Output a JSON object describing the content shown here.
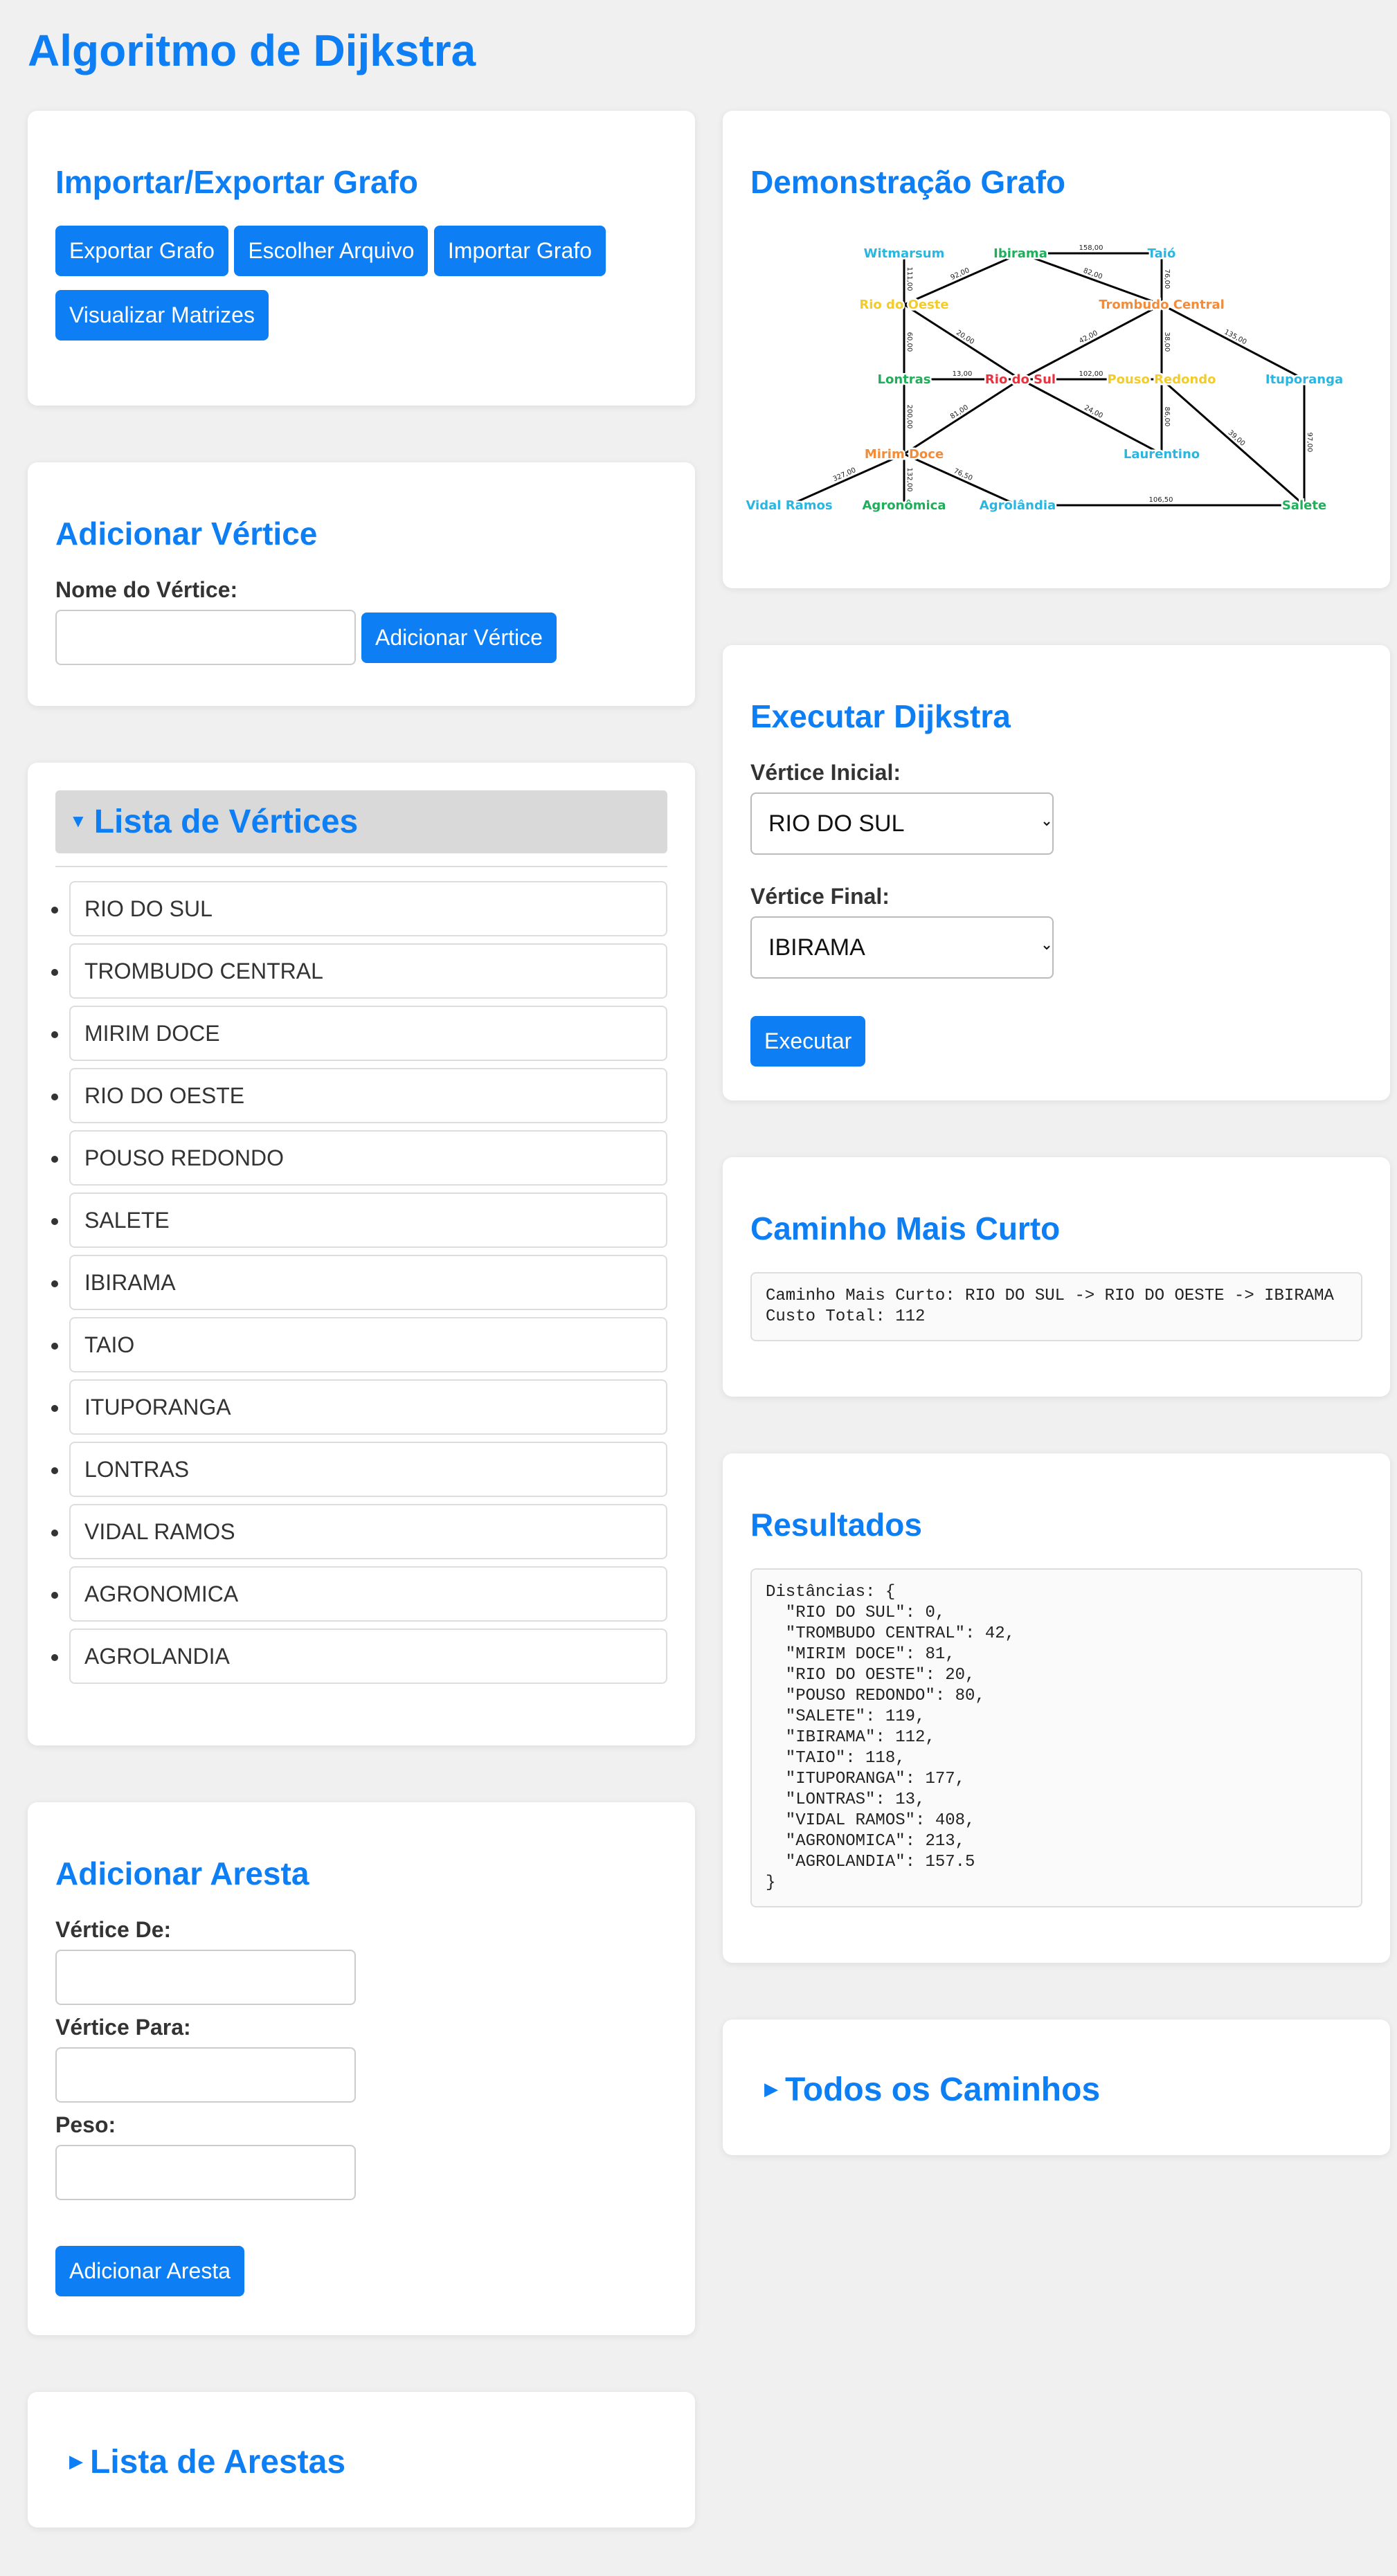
{
  "page": {
    "title": "Algoritmo de Dijkstra"
  },
  "import_export": {
    "title": "Importar/Exportar Grafo",
    "export_label": "Exportar Grafo",
    "choose_file_label": "Escolher Arquivo",
    "import_label": "Importar Grafo",
    "view_matrices_label": "Visualizar Matrizes"
  },
  "add_vertex": {
    "title": "Adicionar Vértice",
    "name_label": "Nome do Vértice:",
    "name_value": "",
    "button_label": "Adicionar Vértice"
  },
  "vertex_list": {
    "title": "Lista de Vértices",
    "toggle_icon": "triangle-down",
    "items": [
      "RIO DO SUL",
      "TROMBUDO CENTRAL",
      "MIRIM DOCE",
      "RIO DO OESTE",
      "POUSO REDONDO",
      "SALETE",
      "IBIRAMA",
      "TAIO",
      "ITUPORANGA",
      "LONTRAS",
      "VIDAL RAMOS",
      "AGRONOMICA",
      "AGROLANDIA"
    ]
  },
  "add_edge": {
    "title": "Adicionar Aresta",
    "from_label": "Vértice De:",
    "from_value": "",
    "to_label": "Vértice Para:",
    "to_value": "",
    "weight_label": "Peso:",
    "weight_value": "",
    "button_label": "Adicionar Aresta"
  },
  "edge_list": {
    "title": "Lista de Arestas",
    "toggle_icon": "triangle-right"
  },
  "graph_demo": {
    "title": "Demonstração Grafo",
    "colors": {
      "green": "#1fae5a",
      "cyan": "#29b6e0",
      "orange": "#f08c3a",
      "yellow": "#f2cc2b",
      "red": "#e8333f"
    },
    "nodes": [
      {
        "id": "witmarsum",
        "label": "Witmarsum",
        "color": "cyan"
      },
      {
        "id": "ibirama",
        "label": "Ibirama",
        "color": "green"
      },
      {
        "id": "taio",
        "label": "Taió",
        "color": "cyan"
      },
      {
        "id": "riooeste",
        "label": "Rio do Oeste",
        "color": "yellow"
      },
      {
        "id": "trombudo",
        "label": "Trombudo Central",
        "color": "orange"
      },
      {
        "id": "lontras",
        "label": "Lontras",
        "color": "green"
      },
      {
        "id": "riosul",
        "label": "Rio do Sul",
        "color": "red"
      },
      {
        "id": "pouso",
        "label": "Pouso Redondo",
        "color": "yellow"
      },
      {
        "id": "ituporanga",
        "label": "Ituporanga",
        "color": "cyan"
      },
      {
        "id": "mirim",
        "label": "Mirim Doce",
        "color": "orange"
      },
      {
        "id": "laurentino",
        "label": "Laurentino",
        "color": "cyan"
      },
      {
        "id": "vidal",
        "label": "Vidal Ramos",
        "color": "cyan"
      },
      {
        "id": "agronomica",
        "label": "Agronômica",
        "color": "green"
      },
      {
        "id": "agrolandia",
        "label": "Agrolândia",
        "color": "cyan"
      },
      {
        "id": "salete",
        "label": "Salete",
        "color": "green"
      }
    ],
    "edges": [
      {
        "from": "ibirama",
        "to": "taio",
        "weight": "158,00"
      },
      {
        "from": "witmarsum",
        "to": "riooeste",
        "weight": "111,00"
      },
      {
        "from": "ibirama",
        "to": "riooeste",
        "weight": "92,00"
      },
      {
        "from": "ibirama",
        "to": "trombudo",
        "weight": "82,00"
      },
      {
        "from": "taio",
        "to": "trombudo",
        "weight": "76,00"
      },
      {
        "from": "riooeste",
        "to": "lontras",
        "weight": "60,00"
      },
      {
        "from": "riooeste",
        "to": "riosul",
        "weight": "20,00"
      },
      {
        "from": "trombudo",
        "to": "riosul",
        "weight": "42,00"
      },
      {
        "from": "trombudo",
        "to": "pouso",
        "weight": "38,00"
      },
      {
        "from": "trombudo",
        "to": "ituporanga",
        "weight": "135,00"
      },
      {
        "from": "lontras",
        "to": "riosul",
        "weight": "13,00"
      },
      {
        "from": "riosul",
        "to": "pouso",
        "weight": "102,00"
      },
      {
        "from": "lontras",
        "to": "mirim",
        "weight": "200,00"
      },
      {
        "from": "riosul",
        "to": "mirim",
        "weight": "81,00"
      },
      {
        "from": "riosul",
        "to": "laurentino",
        "weight": "24,00"
      },
      {
        "from": "pouso",
        "to": "laurentino",
        "weight": "86,00"
      },
      {
        "from": "pouso",
        "to": "salete",
        "weight": "39,00"
      },
      {
        "from": "ituporanga",
        "to": "salete",
        "weight": "97,00"
      },
      {
        "from": "mirim",
        "to": "vidal",
        "weight": "327,00"
      },
      {
        "from": "mirim",
        "to": "agronomica",
        "weight": "132,00"
      },
      {
        "from": "mirim",
        "to": "agrolandia",
        "weight": "76,50"
      },
      {
        "from": "agrolandia",
        "to": "salete",
        "weight": "106,50"
      }
    ]
  },
  "run_dijkstra": {
    "title": "Executar Dijkstra",
    "start_label": "Vértice Inicial:",
    "start_value": "RIO DO SUL",
    "end_label": "Vértice Final:",
    "end_value": "IBIRAMA",
    "button_label": "Executar"
  },
  "shortest_path": {
    "title": "Caminho Mais Curto",
    "text": "Caminho Mais Curto: RIO DO SUL -> RIO DO OESTE -> IBIRAMA\nCusto Total: 112"
  },
  "results": {
    "title": "Resultados",
    "text": "Distâncias: {\n  \"RIO DO SUL\": 0,\n  \"TROMBUDO CENTRAL\": 42,\n  \"MIRIM DOCE\": 81,\n  \"RIO DO OESTE\": 20,\n  \"POUSO REDONDO\": 80,\n  \"SALETE\": 119,\n  \"IBIRAMA\": 112,\n  \"TAIO\": 118,\n  \"ITUPORANGA\": 177,\n  \"LONTRAS\": 13,\n  \"VIDAL RAMOS\": 408,\n  \"AGRONOMICA\": 213,\n  \"AGROLANDIA\": 157.5\n}"
  },
  "all_paths": {
    "title": "Todos os Caminhos",
    "toggle_icon": "triangle-right"
  }
}
